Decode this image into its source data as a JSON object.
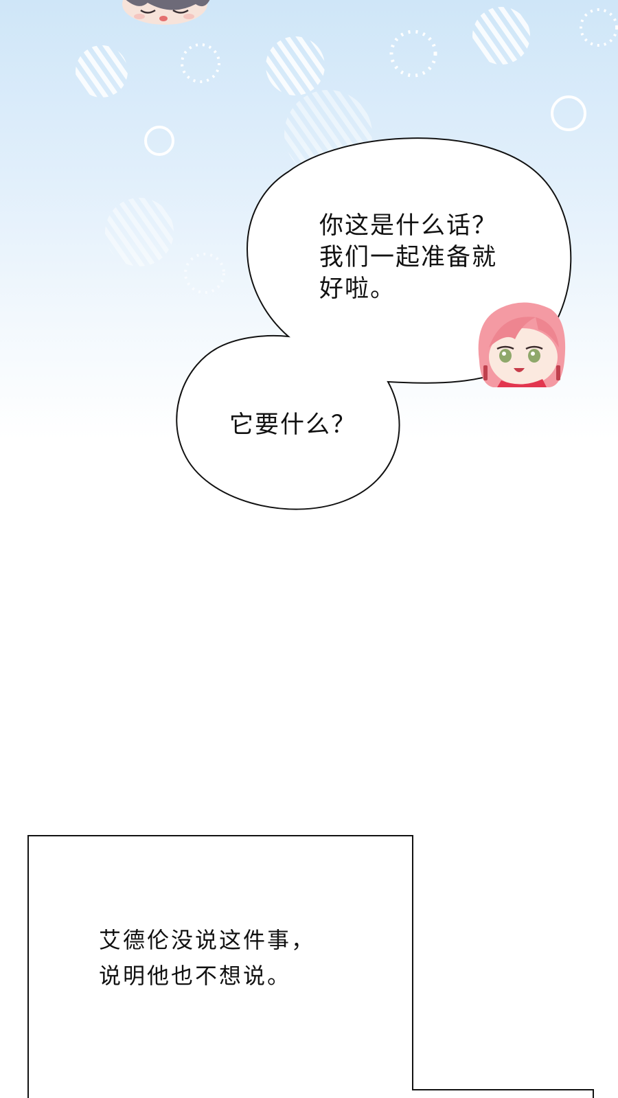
{
  "page": {
    "background_top_color": "#cfe6f8",
    "background_bottom_color": "#ffffff"
  },
  "speech": {
    "line1": "你这是什么话？\n我们一起准备就\n好啦。",
    "line2": "它要什么？"
  },
  "narration": {
    "text": "艾德伦没说这件事，\n说明他也不想说。"
  },
  "characters": {
    "top_chibi": "sleepy-boy-chibi-icon",
    "speaker_chibi": "pink-hair-girl-chibi-icon"
  }
}
